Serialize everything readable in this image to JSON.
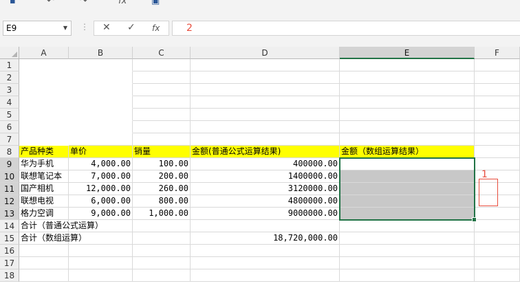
{
  "toolbar": {
    "icons": [
      "save-icon",
      "undo-icon",
      "redo-icon",
      "fx-icon",
      "table-icon"
    ],
    "fx_label": "fx"
  },
  "formula_bar": {
    "name_box": "E9",
    "cancel_glyph": "✕",
    "enter_glyph": "✓",
    "fx_glyph": "fx",
    "value": "2"
  },
  "columns": [
    "A",
    "B",
    "C",
    "D",
    "E",
    "F"
  ],
  "rows": [
    "1",
    "2",
    "3",
    "4",
    "5",
    "6",
    "7",
    "8",
    "9",
    "10",
    "11",
    "12",
    "13",
    "14",
    "15",
    "16",
    "17",
    "18"
  ],
  "header_row": {
    "a": "产品种类",
    "b": "单价",
    "c": "销量",
    "d": "金额(普通公式运算结果)",
    "e": "金额（数组运算结果）"
  },
  "products": [
    {
      "name": "华为手机",
      "price": "4,000.00",
      "qty": "100.00",
      "amount": "400000.00"
    },
    {
      "name": "联想笔记本",
      "price": "7,000.00",
      "qty": "200.00",
      "amount": "1400000.00"
    },
    {
      "name": "国产相机",
      "price": "12,000.00",
      "qty": "260.00",
      "amount": "3120000.00"
    },
    {
      "name": "联想电视",
      "price": "6,000.00",
      "qty": "800.00",
      "amount": "4800000.00"
    },
    {
      "name": "格力空调",
      "price": "9,000.00",
      "qty": "1,000.00",
      "amount": "9000000.00"
    }
  ],
  "totals": {
    "row14_label": "合计（普通公式运算）",
    "row15_label": "合计（数组运算）",
    "row15_value": "18,720,000.00"
  },
  "annotation": {
    "label": "1",
    "color": "#e84d3d"
  },
  "colors": {
    "accent": "#217346",
    "highlight": "#ffff00",
    "selected_fill": "#c8c8c8"
  }
}
